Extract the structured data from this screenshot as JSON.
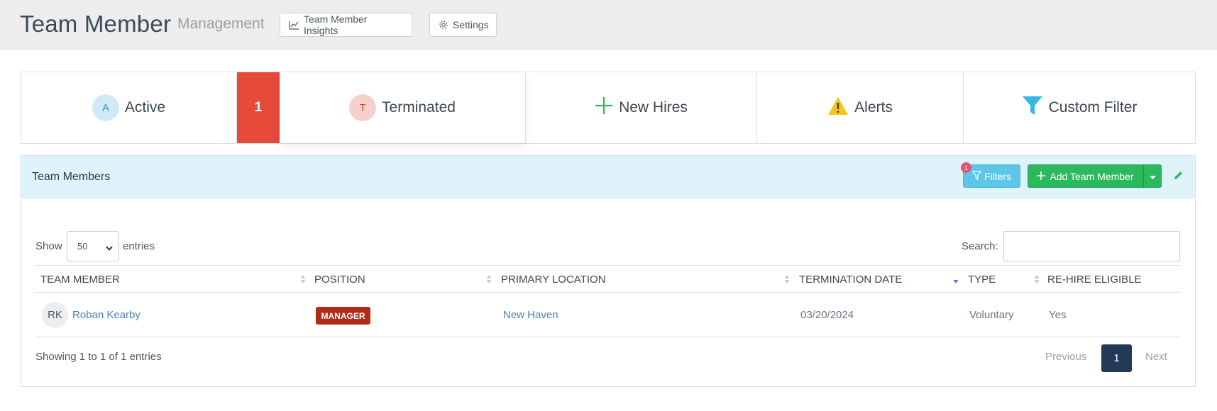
{
  "header": {
    "title": "Team Member",
    "subtitle": "Management",
    "insights_button": "Team Member Insights",
    "settings_button": "Settings"
  },
  "status_tabs": {
    "active": {
      "initial": "A",
      "label": "Active"
    },
    "terminated_count": "1",
    "terminated": {
      "initial": "T",
      "label": "Terminated"
    },
    "new_hires": {
      "label": "New Hires"
    },
    "alerts": {
      "label": "Alerts"
    },
    "custom_filter": {
      "label": "Custom Filter"
    }
  },
  "colors": {
    "count_box": "#e64a3b",
    "filters_button": "#5bc6e8",
    "add_button": "#2cb95c",
    "position_badge": "#b32a16",
    "active_page": "#233a57"
  },
  "panel": {
    "title": "Team Members",
    "filters_badge": "1",
    "filters_button": "Filters",
    "add_button": "Add Team Member"
  },
  "table_controls": {
    "show_label": "Show",
    "page_length": "50",
    "entries_label": "entries",
    "search_label": "Search:",
    "search_value": ""
  },
  "table": {
    "columns": [
      "TEAM MEMBER",
      "POSITION",
      "PRIMARY LOCATION",
      "TERMINATION DATE",
      "TYPE",
      "RE-HIRE ELIGIBLE"
    ],
    "rows": [
      {
        "initials": "RK",
        "name": "Roban Kearby",
        "position": "MANAGER",
        "location": "New Haven",
        "termination_date": "03/20/2024",
        "type": "Voluntary",
        "rehire_eligible": "Yes"
      }
    ]
  },
  "footer": {
    "info": "Showing 1 to 1 of 1 entries",
    "previous": "Previous",
    "current_page": "1",
    "next": "Next"
  }
}
